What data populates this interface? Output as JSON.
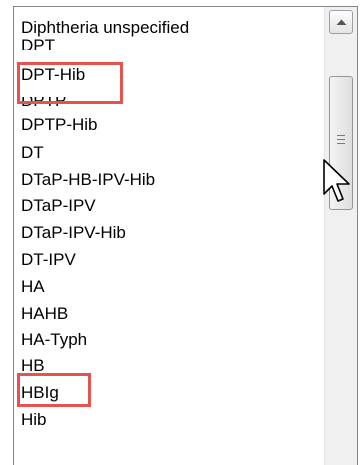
{
  "listbox": {
    "items": [
      "Diphtheria unspecified",
      "DPT",
      "DPT-Hib",
      "DPTP",
      "DPTP-Hib",
      "DT",
      "DTaP-HB-IPV-Hib",
      "DTaP-IPV",
      "DTaP-IPV-Hib",
      "DT-IPV",
      "HA",
      "HAHB",
      "HA-Typh",
      "HB",
      "HBIg",
      "Hib"
    ],
    "highlighted_items": [
      "DPT-Hib",
      "HB"
    ],
    "highlight_color": "#e5534f"
  },
  "scrollbar": {
    "up_arrow_icon": "chevron-up-icon",
    "thumb_grip_icon": "grip-lines-icon"
  },
  "cursor": {
    "icon": "mouse-pointer-icon"
  }
}
